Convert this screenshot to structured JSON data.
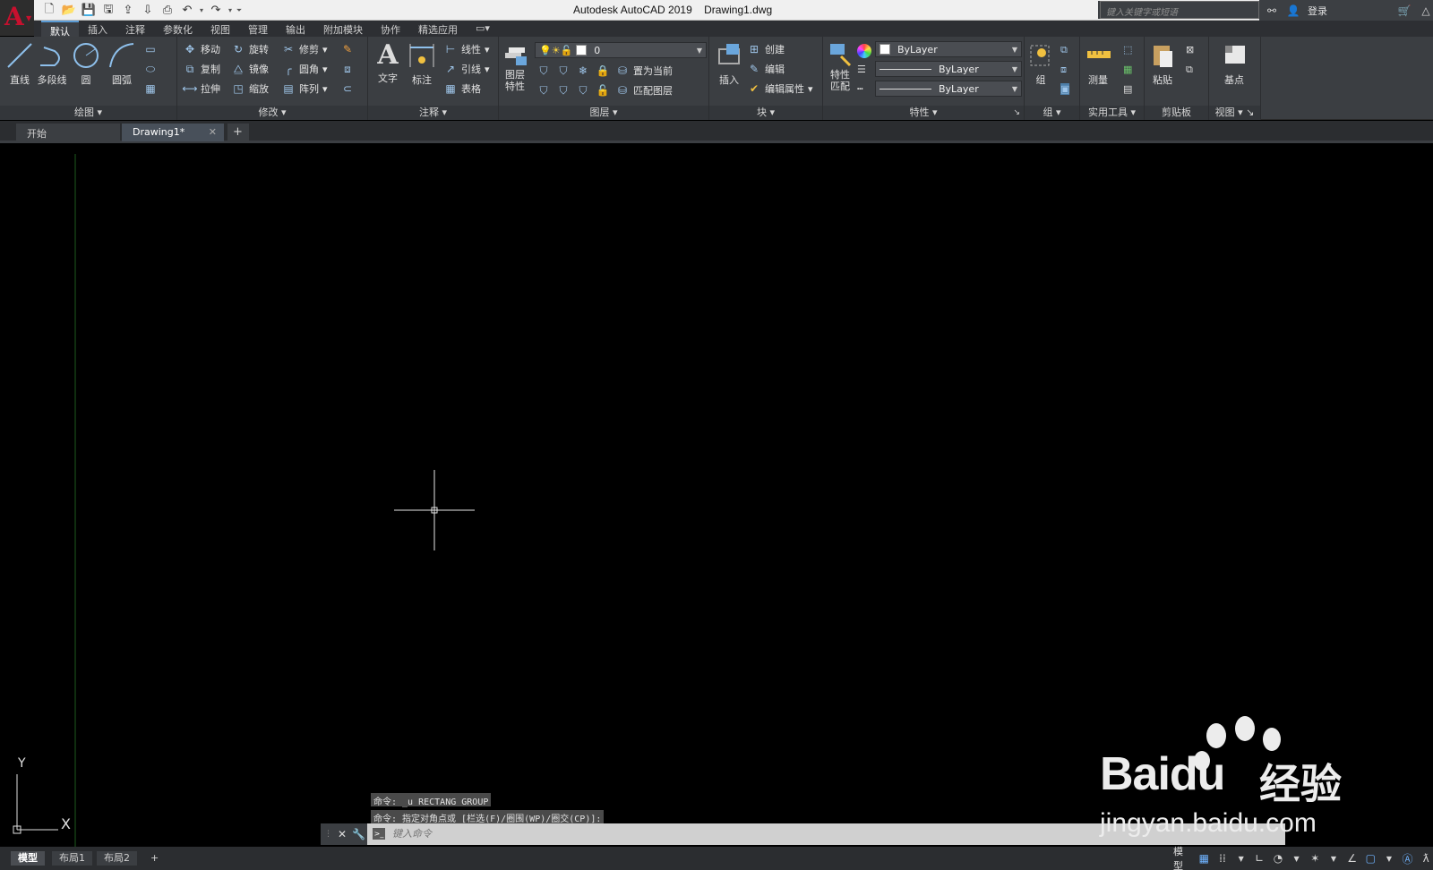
{
  "titlebar": {
    "app_name": "Autodesk AutoCAD 2019",
    "doc_name": "Drawing1.dwg",
    "search_placeholder": "键入关键字或短语",
    "login_label": "登录"
  },
  "ribbon_tabs": [
    "默认",
    "插入",
    "注释",
    "参数化",
    "视图",
    "管理",
    "输出",
    "附加模块",
    "协作",
    "精选应用"
  ],
  "panels": {
    "draw": {
      "title": "绘图",
      "line": "直线",
      "polyline": "多段线",
      "circle": "圆",
      "arc": "圆弧"
    },
    "modify": {
      "title": "修改",
      "move": "移动",
      "rotate": "旋转",
      "trim": "修剪",
      "copy": "复制",
      "mirror": "镜像",
      "fillet": "圆角",
      "stretch": "拉伸",
      "scale": "缩放",
      "array": "阵列"
    },
    "annotation": {
      "title": "注释",
      "text": "文字",
      "dimension": "标注",
      "linear": "线性",
      "leader": "引线",
      "table": "表格"
    },
    "layers": {
      "title": "图层",
      "layer_props": "图层特性",
      "current_layer": "0",
      "set_current": "置为当前",
      "match_layer": "匹配图层"
    },
    "block": {
      "title": "块",
      "insert": "插入",
      "create": "创建",
      "edit": "编辑",
      "edit_attributes": "编辑属性"
    },
    "properties": {
      "title": "特性",
      "match": "特性匹配",
      "color": "ByLayer",
      "linetype": "ByLayer",
      "lineweight": "ByLayer"
    },
    "groups": {
      "title": "组",
      "group": "组"
    },
    "utilities": {
      "title": "实用工具",
      "measure": "测量"
    },
    "clipboard": {
      "title": "剪贴板",
      "paste": "粘贴"
    },
    "view": {
      "title": "视图",
      "basepoint": "基点"
    }
  },
  "file_tabs": {
    "start": "开始",
    "drawing": "Drawing1*"
  },
  "command_history": [
    "命令: _u RECTANG GROUP",
    "命令: 指定对角点或 [栏选(F)/圈围(WP)/圈交(CP)]:"
  ],
  "command_input_placeholder": "键入命令",
  "ucs": {
    "x_label": "X",
    "y_label": "Y"
  },
  "layout_tabs": [
    "模型",
    "布局1",
    "布局2"
  ],
  "status": {
    "model_label": "模型"
  },
  "watermark": {
    "brand": "Baidu",
    "brand_cn": "经验",
    "url": "jingyan.baidu.com"
  },
  "colors": {
    "canvas": "#000000",
    "ribbon": "#3b3e42",
    "accent": "#5a9bd5",
    "logo": "#c8102e"
  }
}
